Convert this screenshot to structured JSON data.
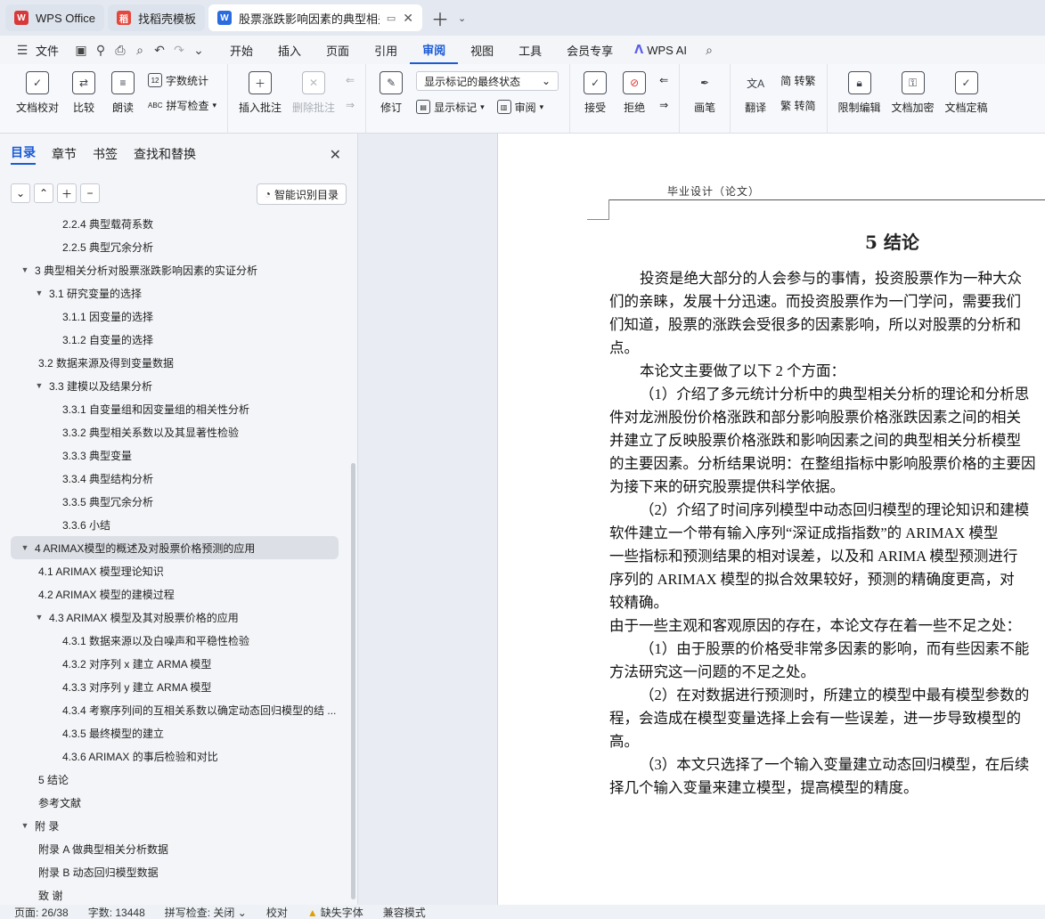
{
  "tabs": [
    {
      "label": "WPS Office",
      "color": "#d9383a",
      "glyph": "W"
    },
    {
      "label": "找稻壳模板",
      "color": "#e5473c",
      "glyph": "稻"
    },
    {
      "label": "股票涨跌影响因素的典型相关分",
      "color": "#2b6be0",
      "glyph": "W"
    }
  ],
  "menu": {
    "file": "文件",
    "items": [
      "开始",
      "插入",
      "页面",
      "引用",
      "审阅",
      "视图",
      "工具",
      "会员专享"
    ],
    "active": "审阅",
    "ai": "WPS AI"
  },
  "ribbon": {
    "doc_check": "文档校对",
    "compare": "比较",
    "read_aloud": "朗读",
    "word_count": "字数统计",
    "spell_check": "拼写检查",
    "insert_comment": "插入批注",
    "delete_comment": "删除批注",
    "track": "修订",
    "markup_select": "显示标记的最终状态",
    "show_markup": "显示标记",
    "review": "审阅",
    "accept": "接受",
    "reject": "拒绝",
    "pen": "画笔",
    "translate": "翻译",
    "to_traditional": "简 转繁",
    "to_simplified": "繁 转简",
    "restrict": "限制编辑",
    "encrypt": "文档加密",
    "finalize": "文档定稿"
  },
  "nav": {
    "tabs": [
      "目录",
      "章节",
      "书签",
      "查找和替换"
    ],
    "active_tab": "目录",
    "smart_btn": "智能识别目录",
    "toc": [
      {
        "text": "2.2.4  典型载荷系数",
        "level": 3,
        "caret": ""
      },
      {
        "text": "2.2.5  典型冗余分析",
        "level": 3,
        "caret": ""
      },
      {
        "text": "3  典型相关分析对股票涨跌影响因素的实证分析",
        "level": 1,
        "caret": "▼"
      },
      {
        "text": "3.1  研究变量的选择",
        "level": 2,
        "caret": "▼"
      },
      {
        "text": "3.1.1  因变量的选择",
        "level": 3,
        "caret": ""
      },
      {
        "text": "3.1.2  自变量的选择",
        "level": 3,
        "caret": ""
      },
      {
        "text": "3.2  数据来源及得到变量数据",
        "level": 2,
        "caret": ""
      },
      {
        "text": "3.3  建模以及结果分析",
        "level": 2,
        "caret": "▼"
      },
      {
        "text": "3.3.1  自变量组和因变量组的相关性分析",
        "level": 3,
        "caret": ""
      },
      {
        "text": "3.3.2  典型相关系数以及其显著性检验",
        "level": 3,
        "caret": ""
      },
      {
        "text": "3.3.3  典型变量",
        "level": 3,
        "caret": ""
      },
      {
        "text": "3.3.4  典型结构分析",
        "level": 3,
        "caret": ""
      },
      {
        "text": "3.3.5  典型冗余分析",
        "level": 3,
        "caret": ""
      },
      {
        "text": "3.3.6  小结",
        "level": 3,
        "caret": ""
      },
      {
        "text": "4 ARIMAX模型的概述及对股票价格预测的应用",
        "level": 1,
        "caret": "▼",
        "selected": true
      },
      {
        "text": "4.1 ARIMAX 模型理论知识",
        "level": 2,
        "caret": ""
      },
      {
        "text": "4.2 ARIMAX 模型的建模过程",
        "level": 2,
        "caret": ""
      },
      {
        "text": "4.3 ARIMAX 模型及其对股票价格的应用",
        "level": 2,
        "caret": "▼"
      },
      {
        "text": "4.3.1  数据来源以及白噪声和平稳性检验",
        "level": 3,
        "caret": ""
      },
      {
        "text": "4.3.2  对序列 x 建立 ARMA 模型",
        "level": 3,
        "caret": ""
      },
      {
        "text": "4.3.3  对序列 y 建立 ARMA 模型",
        "level": 3,
        "caret": ""
      },
      {
        "text": "4.3.4  考察序列间的互相关系数以确定动态回归模型的结 ...",
        "level": 3,
        "caret": ""
      },
      {
        "text": "4.3.5  最终模型的建立",
        "level": 3,
        "caret": ""
      },
      {
        "text": "4.3.6 ARIMAX 的事后检验和对比",
        "level": 3,
        "caret": ""
      },
      {
        "text": "5  结论",
        "level": 0,
        "caret": ""
      },
      {
        "text": "参考文献",
        "level": 0,
        "caret": ""
      },
      {
        "text": "附  录",
        "level": 1,
        "caret": "▼"
      },
      {
        "text": "附录 A  做典型相关分析数据",
        "level": 2,
        "caret": ""
      },
      {
        "text": "附录 B  动态回归模型数据",
        "level": 2,
        "caret": ""
      },
      {
        "text": "致  谢",
        "level": 0,
        "caret": ""
      }
    ]
  },
  "doc": {
    "header": "毕业设计（论文）",
    "chapter": "5  结论",
    "paragraphs": [
      {
        "text": "投资是绝大部分的人会参与的事情，投资股票作为一种大众",
        "indent": true
      },
      {
        "text": "们的亲睐，发展十分迅速。而投资股票作为一门学问，需要我们",
        "indent": false
      },
      {
        "text": "们知道，股票的涨跌会受很多的因素影响，所以对股票的分析和",
        "indent": false
      },
      {
        "text": "点。",
        "indent": false
      },
      {
        "text": "本论文主要做了以下 2 个方面：",
        "indent": true
      },
      {
        "text": "（1）介绍了多元统计分析中的典型相关分析的理论和分析思",
        "indent": true
      },
      {
        "text": "件对龙洲股份价格涨跌和部分影响股票价格涨跌因素之间的相关",
        "indent": false
      },
      {
        "text": "并建立了反映股票价格涨跌和影响因素之间的典型相关分析模型",
        "indent": false
      },
      {
        "text": "的主要因素。分析结果说明：在整组指标中影响股票价格的主要因",
        "indent": false
      },
      {
        "text": "为接下来的研究股票提供科学依据。",
        "indent": false
      },
      {
        "text": "（2）介绍了时间序列模型中动态回归模型的理论知识和建模",
        "indent": true
      },
      {
        "text": "软件建立一个带有输入序列“深证成指指数”的 ARIMAX 模型",
        "indent": false
      },
      {
        "text": "一些指标和预测结果的相对误差，以及和 ARIMA 模型预测进行",
        "indent": false
      },
      {
        "text": "序列的 ARIMAX 模型的拟合效果较好，预测的精确度更高，对",
        "indent": false
      },
      {
        "text": "较精确。",
        "indent": false
      },
      {
        "text": "由于一些主观和客观原因的存在，本论文存在着一些不足之处：",
        "indent": false
      },
      {
        "text": "（1）由于股票的价格受非常多因素的影响，而有些因素不能",
        "indent": true
      },
      {
        "text": "方法研究这一问题的不足之处。",
        "indent": false
      },
      {
        "text": "（2）在对数据进行预测时，所建立的模型中最有模型参数的",
        "indent": true
      },
      {
        "text": "程，会造成在模型变量选择上会有一些误差，进一步导致模型的",
        "indent": false
      },
      {
        "text": "高。",
        "indent": false
      },
      {
        "text": "（3）本文只选择了一个输入变量建立动态回归模型，在后续",
        "indent": true
      },
      {
        "text": "择几个输入变量来建立模型，提高模型的精度。",
        "indent": false
      }
    ]
  },
  "status": {
    "page": "页面: 26/38",
    "words": "字数: 13448",
    "spell": "拼写检查: 关闭",
    "proof": "校对",
    "missing_font": "缺失字体",
    "compat": "兼容模式"
  }
}
